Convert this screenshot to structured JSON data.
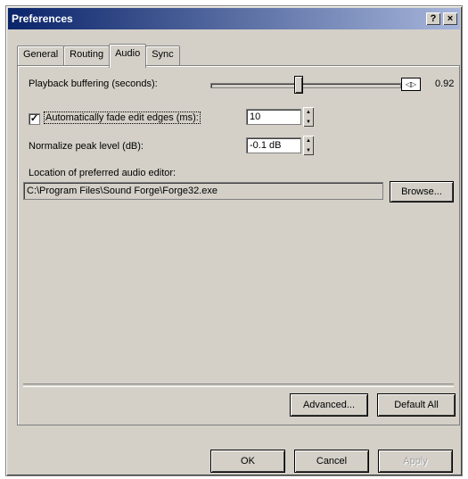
{
  "window": {
    "title": "Preferences",
    "help_btn": "?",
    "close_btn": "×"
  },
  "tabs": [
    {
      "label": "General"
    },
    {
      "label": "Routing"
    },
    {
      "label": "Audio"
    },
    {
      "label": "Sync"
    }
  ],
  "audio": {
    "playback_label": "Playback buffering (seconds):",
    "playback_value": "0.92",
    "playback_level": 0.46,
    "meter_icon": "◁▷",
    "auto_fade_label": "Automatically fade edit edges (ms):",
    "auto_fade_checked": "✓",
    "auto_fade_value": "10",
    "normalize_label": "Normalize peak level (dB):",
    "normalize_value": "-0.1 dB",
    "editor_location_label": "Location of preferred audio editor:",
    "editor_path": "C:\\Program Files\\Sound Forge\\Forge32.exe",
    "browse_label": "Browse...",
    "advanced_label": "Advanced...",
    "default_all_label": "Default All"
  },
  "footer": {
    "ok_label": "OK",
    "cancel_label": "Cancel",
    "apply_label": "Apply"
  }
}
